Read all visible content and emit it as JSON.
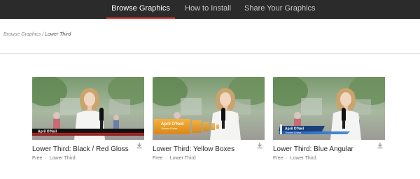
{
  "nav": {
    "tabs": [
      {
        "label": "Browse Graphics",
        "active": true
      },
      {
        "label": "How to Install",
        "active": false
      },
      {
        "label": "Share Your Graphics",
        "active": false
      }
    ],
    "accent_color": "#e03a2f",
    "background_color": "#2b2b2b"
  },
  "breadcrumb": {
    "parent": "Browse Graphics",
    "separator": "/",
    "current": "Lower Third"
  },
  "cards": [
    {
      "title": "Lower Third: Black / Red Gloss",
      "price": "Free",
      "category": "Lower Third",
      "overlay_name": "April O'Neil",
      "icon": "download-icon"
    },
    {
      "title": "Lower Third: Yellow Boxes",
      "price": "Free",
      "category": "Lower Third",
      "overlay_name": "April O'Neil",
      "overlay_subtitle": "Channel 6 News",
      "icon": "download-icon"
    },
    {
      "title": "Lower Third: Blue Angular",
      "price": "Free",
      "category": "Lower Third",
      "overlay_name": "April O'Neil",
      "overlay_subtitle": "Channel 6 News",
      "icon": "download-icon"
    }
  ]
}
